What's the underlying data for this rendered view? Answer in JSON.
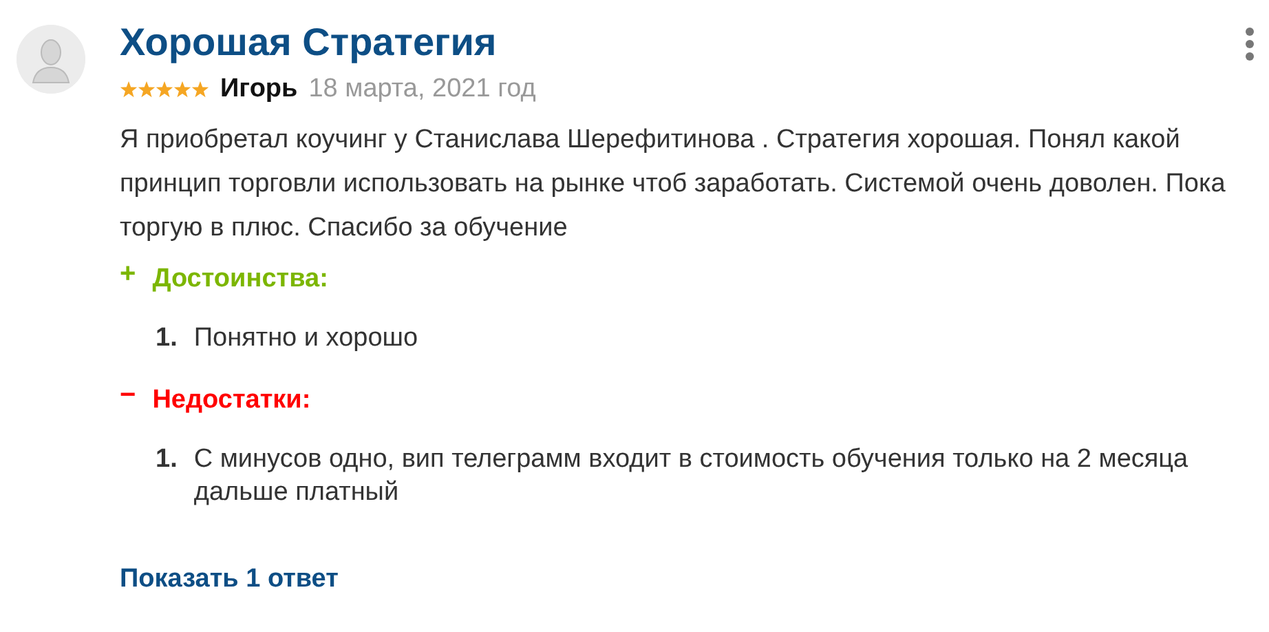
{
  "review": {
    "title": "Хорошая Стратегия",
    "stars": 5,
    "author": "Игорь",
    "date": "18 марта, 2021 год",
    "text": "Я приобретал коучинг у Станислава Шерефитинова . Стратегия хорошая. Понял какой принцип торговли использовать на рынке чтоб заработать. Системой очень доволен. Пока торгую в плюс. Спасибо за обучение",
    "sections": [
      {
        "kind": "pros",
        "sign": "+",
        "heading": "Достоинства:",
        "items": [
          {
            "number": "1.",
            "text": "Понятно и хорошо"
          }
        ]
      },
      {
        "kind": "cons",
        "sign": "−",
        "heading": "Недостатки:",
        "items": [
          {
            "number": "1.",
            "text": "С минусов одно, вип телеграмм входит в стоимость обучения только на 2 месяца дальше платный"
          }
        ]
      }
    ],
    "replies_link": "Показать 1 ответ"
  }
}
